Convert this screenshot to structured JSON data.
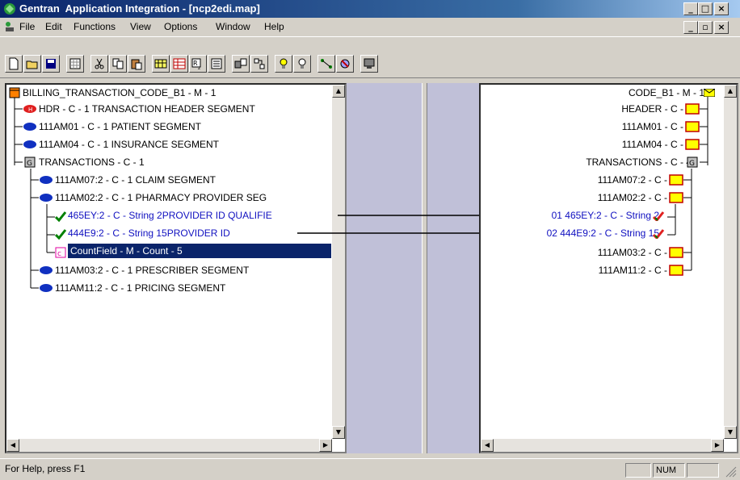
{
  "window": {
    "app_name": "Gentran",
    "title": "Application Integration - [ncp2edi.map]"
  },
  "menu": {
    "file": "File",
    "edit": "Edit",
    "functions": "Functions",
    "view": "View",
    "options": "Options",
    "window": "Window",
    "help": "Help"
  },
  "toolbar": {
    "icons": [
      "new-icon",
      "open-icon",
      "save-icon",
      "grid-icon",
      "cut-icon",
      "copy-icon",
      "paste-icon",
      "map-icon",
      "table-icon",
      "field-icon",
      "list-icon",
      "group-icon",
      "tree-icon",
      "bulb-on-icon",
      "bulb-off-icon",
      "link-icon",
      "unlink-icon",
      "properties-icon"
    ]
  },
  "left_tree": {
    "root": "BILLING_TRANSACTION_CODE_B1 - M - 1",
    "items": [
      {
        "label": "HDR - C - 1 TRANSACTION HEADER SEGMENT"
      },
      {
        "label": "111AM01 - C - 1 PATIENT SEGMENT"
      },
      {
        "label": "111AM04 - C - 1 INSURANCE SEGMENT"
      },
      {
        "label": "TRANSACTIONS - C - 1"
      },
      {
        "label": "111AM07:2 - C - 1 CLAIM SEGMENT"
      },
      {
        "label": "111AM02:2 - C - 1 PHARMACY PROVIDER SEG"
      },
      {
        "label": "465EY:2 - C - String 2PROVIDER ID QUALIFIE"
      },
      {
        "label": "444E9:2 - C - String 15PROVIDER ID"
      },
      {
        "label": "CountField - M - Count - 5"
      },
      {
        "label": "111AM03:2 - C - 1 PRESCRIBER SEGMENT"
      },
      {
        "label": "111AM11:2 - C - 1 PRICING SEGMENT"
      }
    ]
  },
  "right_tree": {
    "root": "CODE_B1 - M - 1",
    "items": [
      {
        "label": "HEADER - C - 1"
      },
      {
        "label": "111AM01 - C - 1"
      },
      {
        "label": "111AM04 - C - 1"
      },
      {
        "label": "TRANSACTIONS - C - 4"
      },
      {
        "label": "111AM07:2 - C - 1"
      },
      {
        "label": "111AM02:2 - C - 1"
      },
      {
        "label": "01 465EY:2 - C - String 2"
      },
      {
        "label": "02 444E9:2 - C - String 15"
      },
      {
        "label": "111AM03:2 - C - 1"
      },
      {
        "label": "111AM11:2 - C - 1"
      }
    ]
  },
  "status": {
    "help_text": "For Help, press F1",
    "num": "NUM"
  },
  "colors": {
    "title_start": "#0a246a",
    "title_end": "#a6caf0",
    "selection": "#0a246a",
    "mapped_text": "#1010c0",
    "segment_icon": "#ffff00"
  }
}
